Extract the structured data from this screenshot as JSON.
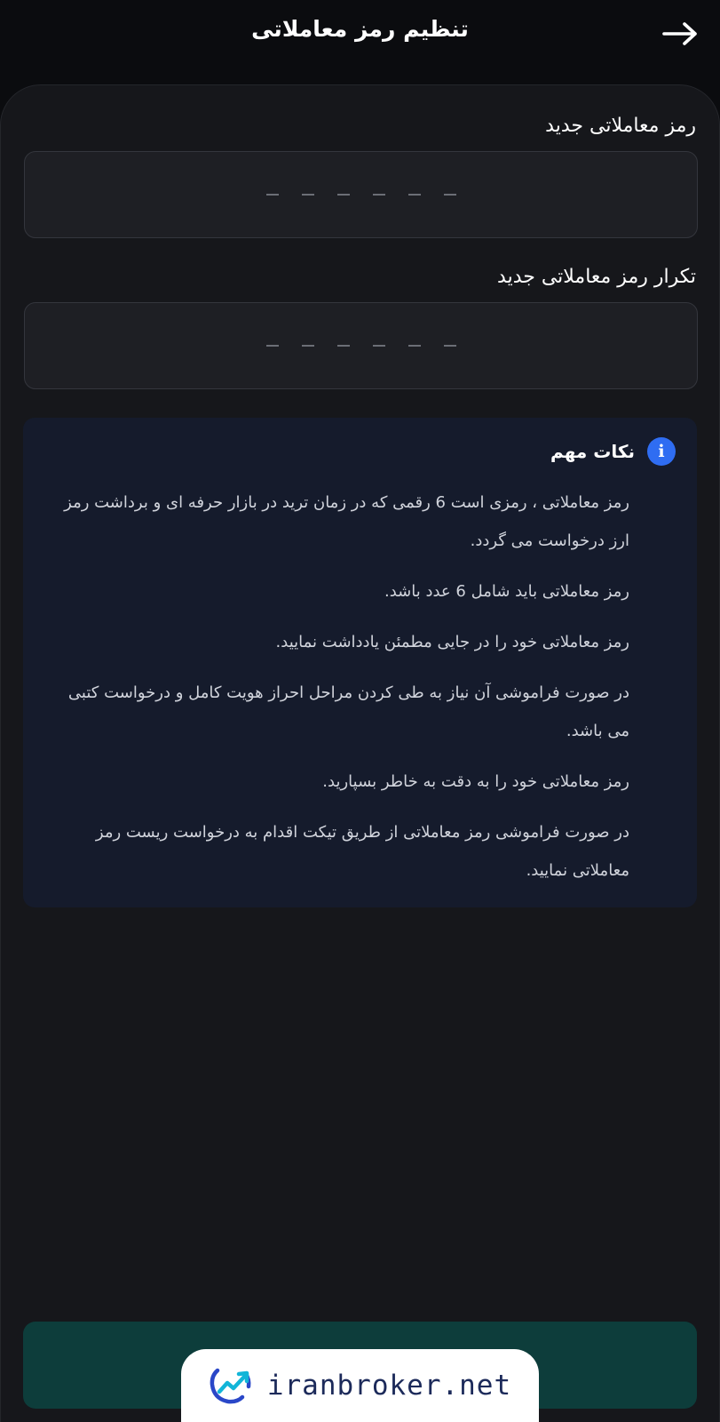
{
  "header": {
    "title": "تنظیم رمز معاملاتی",
    "back_icon": "arrow-right-icon"
  },
  "form": {
    "new_pin_label": "رمز معاملاتی جدید",
    "confirm_pin_label": "تکرار رمز معاملاتی جدید",
    "pin_length": 6
  },
  "notes": {
    "icon": "info-icon",
    "icon_glyph": "i",
    "title": "نکات مهم",
    "items": [
      "رمز معاملاتی ، رمزی است 6 رقمی که در زمان ترید در بازار حرفه ای و برداشت رمز ارز درخواست می گردد.",
      "رمز معاملاتی باید شامل 6 عدد باشد.",
      "رمز معاملاتی خود را در جایی مطمئن یادداشت نمایید.",
      "در صورت فراموشی آن نیاز به طی کردن مراحل احراز هویت کامل و درخواست کتبی می باشد.",
      "رمز معاملاتی خود را به دقت به خاطر بسپارید.",
      "در صورت فراموشی رمز معاملاتی از طریق تیکت اقدام به درخواست ریست رمز معاملاتی نمایید."
    ]
  },
  "watermark": {
    "text": "iranbroker.net",
    "icon": "iranbroker-logo-icon"
  },
  "colors": {
    "background": "#0b0c0f",
    "panel": "#16171b",
    "input": "#1e1f24",
    "notes_bg": "#151b2c",
    "info_accent": "#2f6df2",
    "submit_button": "#0d3d3b"
  }
}
